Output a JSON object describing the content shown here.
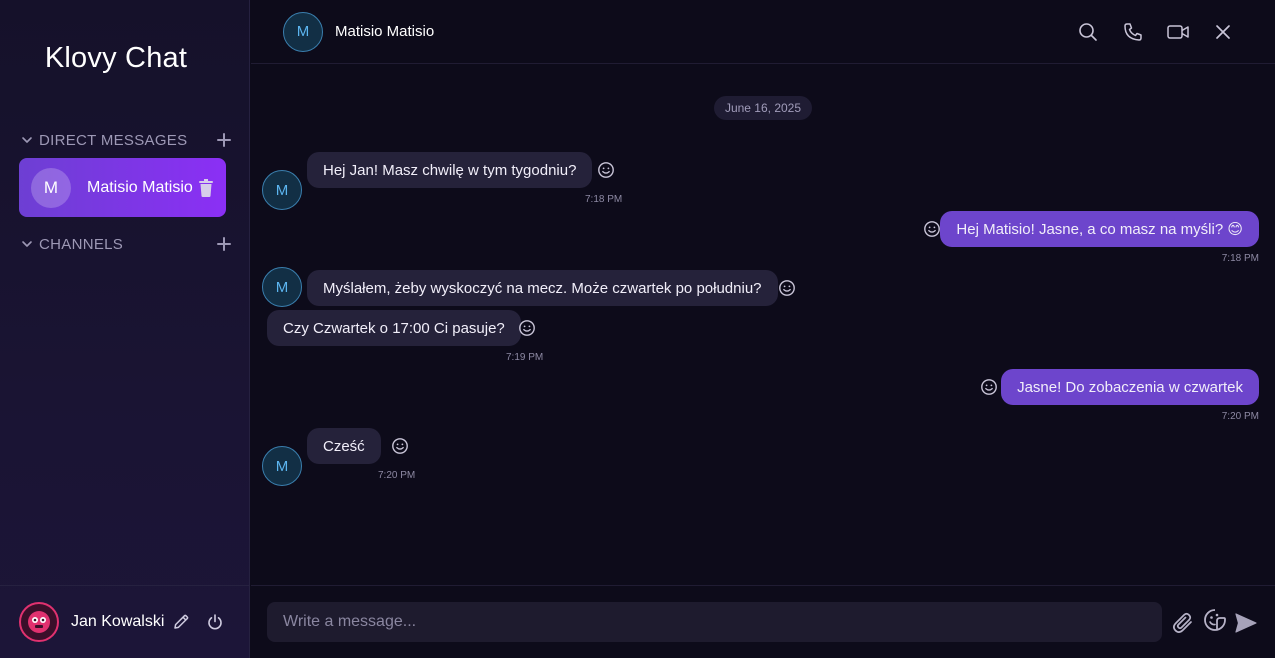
{
  "app": {
    "title": "Klovy Chat"
  },
  "sidebar": {
    "sections": [
      {
        "label": "DIRECT MESSAGES"
      },
      {
        "label": "CHANNELS"
      }
    ],
    "direct_messages": [
      {
        "initial": "M",
        "name": "Matisio Matisio"
      }
    ],
    "user": {
      "name": "Jan Kowalski"
    }
  },
  "conversation": {
    "contact": {
      "initial": "M",
      "name": "Matisio Matisio"
    },
    "date_separator": "June 16, 2025",
    "messages": [
      {
        "direction": "in",
        "text": "Hej Jan! Masz chwilę w tym tygodniu?",
        "time": "7:18 PM"
      },
      {
        "direction": "out",
        "text": "Hej Matisio! Jasne, a co masz na myśli? 😊",
        "time": "7:18 PM"
      },
      {
        "direction": "in",
        "text": "Myślałem, żeby wyskoczyć na mecz. Może czwartek po południu?",
        "time": ""
      },
      {
        "direction": "in",
        "text": "Czy Czwartek o 17:00 Ci pasuje?",
        "time": "7:19 PM"
      },
      {
        "direction": "out",
        "text": "Jasne! Do zobaczenia w czwartek",
        "time": "7:20 PM"
      },
      {
        "direction": "in",
        "text": "Cześć",
        "time": "7:20 PM"
      }
    ]
  },
  "composer": {
    "placeholder": "Write a message..."
  },
  "colors": {
    "accent": "#8b2ff5",
    "outgoing_bubble": "#6d45cc",
    "incoming_bubble": "#25223a",
    "background": "#0d0b1a"
  },
  "icons": {
    "topbar": [
      "search-icon",
      "phone-icon",
      "video-icon",
      "close-icon"
    ],
    "composer": [
      "paperclip-icon",
      "sticker-icon",
      "send-icon"
    ]
  }
}
